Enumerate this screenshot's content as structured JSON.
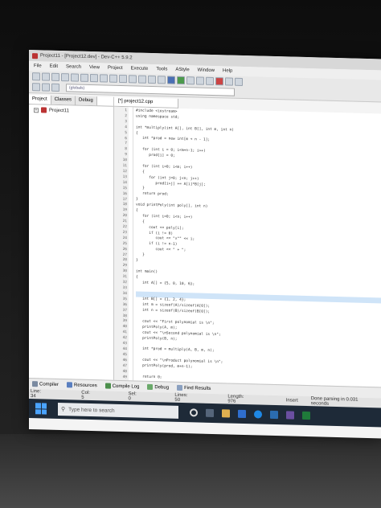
{
  "window": {
    "title": "Project11 - [Project12.dev] - Dev-C++ 5.9.2"
  },
  "menu": [
    "File",
    "Edit",
    "Search",
    "View",
    "Project",
    "Execute",
    "Tools",
    "AStyle",
    "Window",
    "Help"
  ],
  "toolbar": {
    "globals_value": "(globals)"
  },
  "left_panel": {
    "tabs": [
      "Project",
      "Classes",
      "Debug"
    ],
    "project_name": "Project11"
  },
  "editor": {
    "file_tab": "[*] project12.cpp",
    "line_numbers": [
      "1",
      "2",
      "3",
      "4",
      "5",
      "6",
      "7",
      "8",
      "9",
      "10",
      "11",
      "12",
      "13",
      "14",
      "15",
      "16",
      "17",
      "18",
      "19",
      "20",
      "21",
      "22",
      "23",
      "24",
      "25",
      "26",
      "27",
      "28",
      "29",
      "30",
      "31",
      "32",
      "33",
      "34",
      "35",
      "36",
      "37",
      "38",
      "39",
      "40",
      "41",
      "42",
      "43",
      "44",
      "45",
      "46",
      "47",
      "48",
      "49"
    ],
    "lines": [
      "#include <iostream>",
      "using namespace std;",
      "",
      "int *multiply(int A[], int B[], int m, int n)",
      "{",
      "   int *prod = new int[m + n - 1];",
      "",
      "   for (int i = 0; i<m+n-1; i++)",
      "      prod[i] = 0;",
      "",
      "   for (int i=0; i<m; i++)",
      "   {",
      "      for (int j=0; j<n; j++)",
      "         prod[i+j] += A[i]*B[j];",
      "   }",
      "   return prod;",
      "}",
      "void printPoly(int poly[], int n)",
      "{",
      "   for (int i=0; i<n; i++)",
      "   {",
      "      cout << poly[i];",
      "      if (i != 0)",
      "         cout << \"x^\" << i;",
      "      if (i != n-1)",
      "         cout << \" + \";",
      "   }",
      "}",
      "",
      "int main()",
      "{",
      "   int A[] = {5, 0, 10, 6};",
      "",
      "",
      "   int B[] = {1, 2, 4};",
      "   int m = sizeof(A)/sizeof(A[0]);",
      "   int n = sizeof(B)/sizeof(B[0]);",
      "",
      "   cout << \"First polynomial is \\n\";",
      "   printPoly(A, m);",
      "   cout << \"\\nSecond polynomial is \\n\";",
      "   printPoly(B, n);",
      "",
      "   int *prod = multiply(A, B, m, n);",
      "",
      "   cout << \"\\nProduct polynomial is \\n\";",
      "   printPoly(prod, m+n-1);",
      "",
      "   return 0;"
    ]
  },
  "bottom_tabs": [
    "Compiler",
    "Resources",
    "Compile Log",
    "Debug",
    "Find Results"
  ],
  "status": {
    "line_label": "Line:",
    "line_value": "34",
    "col_label": "Col:",
    "col_value": "5",
    "sel_label": "Sel:",
    "sel_value": "0",
    "lines_label": "Lines:",
    "lines_value": "50",
    "length_label": "Length:",
    "length_value": "976",
    "mode": "Insert",
    "message": "Done parsing in 0.031 seconds"
  },
  "taskbar": {
    "search_placeholder": "Type here to search"
  }
}
